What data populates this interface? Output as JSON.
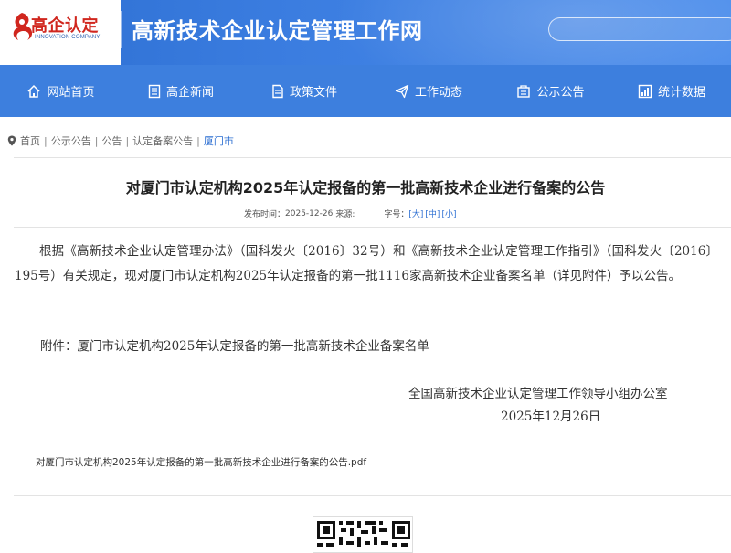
{
  "header": {
    "logo_text": "高企认定",
    "logo_en": "INNOVATION COMPANY",
    "site_title": "高新技术企业认定管理工作网",
    "search_placeholder": ""
  },
  "nav": [
    {
      "label": "网站首页",
      "icon": "home-icon"
    },
    {
      "label": "高企新闻",
      "icon": "news-icon"
    },
    {
      "label": "政策文件",
      "icon": "document-icon"
    },
    {
      "label": "工作动态",
      "icon": "send-icon"
    },
    {
      "label": "公示公告",
      "icon": "announcement-icon"
    },
    {
      "label": "统计数据",
      "icon": "statistics-icon"
    }
  ],
  "breadcrumb": [
    "首页",
    "公示公告",
    "公告",
    "认定备案公告",
    "厦门市"
  ],
  "article": {
    "title": "对厦门市认定机构2025年认定报备的第一批高新技术企业进行备案的公告",
    "meta_prefix": "发布时间：",
    "date": "2025-12-26",
    "source_label": "来源:",
    "font_size_label": "字号：",
    "font_sizes": [
      "[大]",
      "[中]",
      "[小]"
    ],
    "body": "根据《高新技术企业认定管理办法》（国科发火〔2016〕32号）和《高新技术企业认定管理工作指引》（国科发火〔2016〕195号）有关规定，现对厦门市认定机构2025年认定报备的第一批1116家高新技术企业备案名单（详见附件）予以公告。",
    "attachment_line": "附件：厦门市认定机构2025年认定报备的第一批高新技术企业备案名单",
    "signature_org": "全国高新技术企业认定管理工作领导小组办公室",
    "signature_date": "2025年12月26日",
    "pdf_link": "对厦门市认定机构2025年认定报备的第一批高新技术企业进行备案的公告.pdf"
  },
  "colors": {
    "header_blue": "#3b7de0",
    "nav_blue": "#3d7fde",
    "logo_red": "#d0261e",
    "link_blue": "#2d6fd2"
  }
}
